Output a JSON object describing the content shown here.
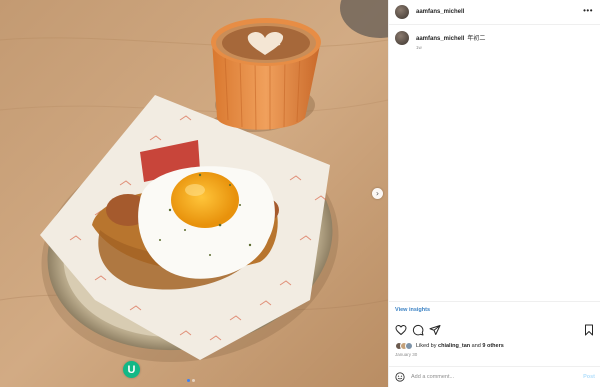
{
  "post": {
    "username": "aamfans_michell",
    "caption_username": "aamfans_michell",
    "caption_text": "年初二",
    "time_ago": "1w",
    "insights_label": "View insights",
    "liked_prefix": "Liked by",
    "liked_user": "chialing_tan",
    "liked_and": "and",
    "liked_others": "9 others",
    "date": "January 30",
    "comment_placeholder": "Add a comment...",
    "post_label": "Post",
    "more_label": "•••",
    "next_label": "›",
    "carousel": {
      "count": 2,
      "active": 1
    },
    "badge_letter": "U"
  },
  "icons": {
    "like": "heart-icon",
    "comment": "comment-icon",
    "share": "share-icon",
    "save": "bookmark-icon",
    "emoji": "emoji-icon"
  },
  "colors": {
    "link": "#3b82c4",
    "muted": "#8e8e8e",
    "post_disabled": "#b2dffc",
    "badge": "#12b886"
  }
}
